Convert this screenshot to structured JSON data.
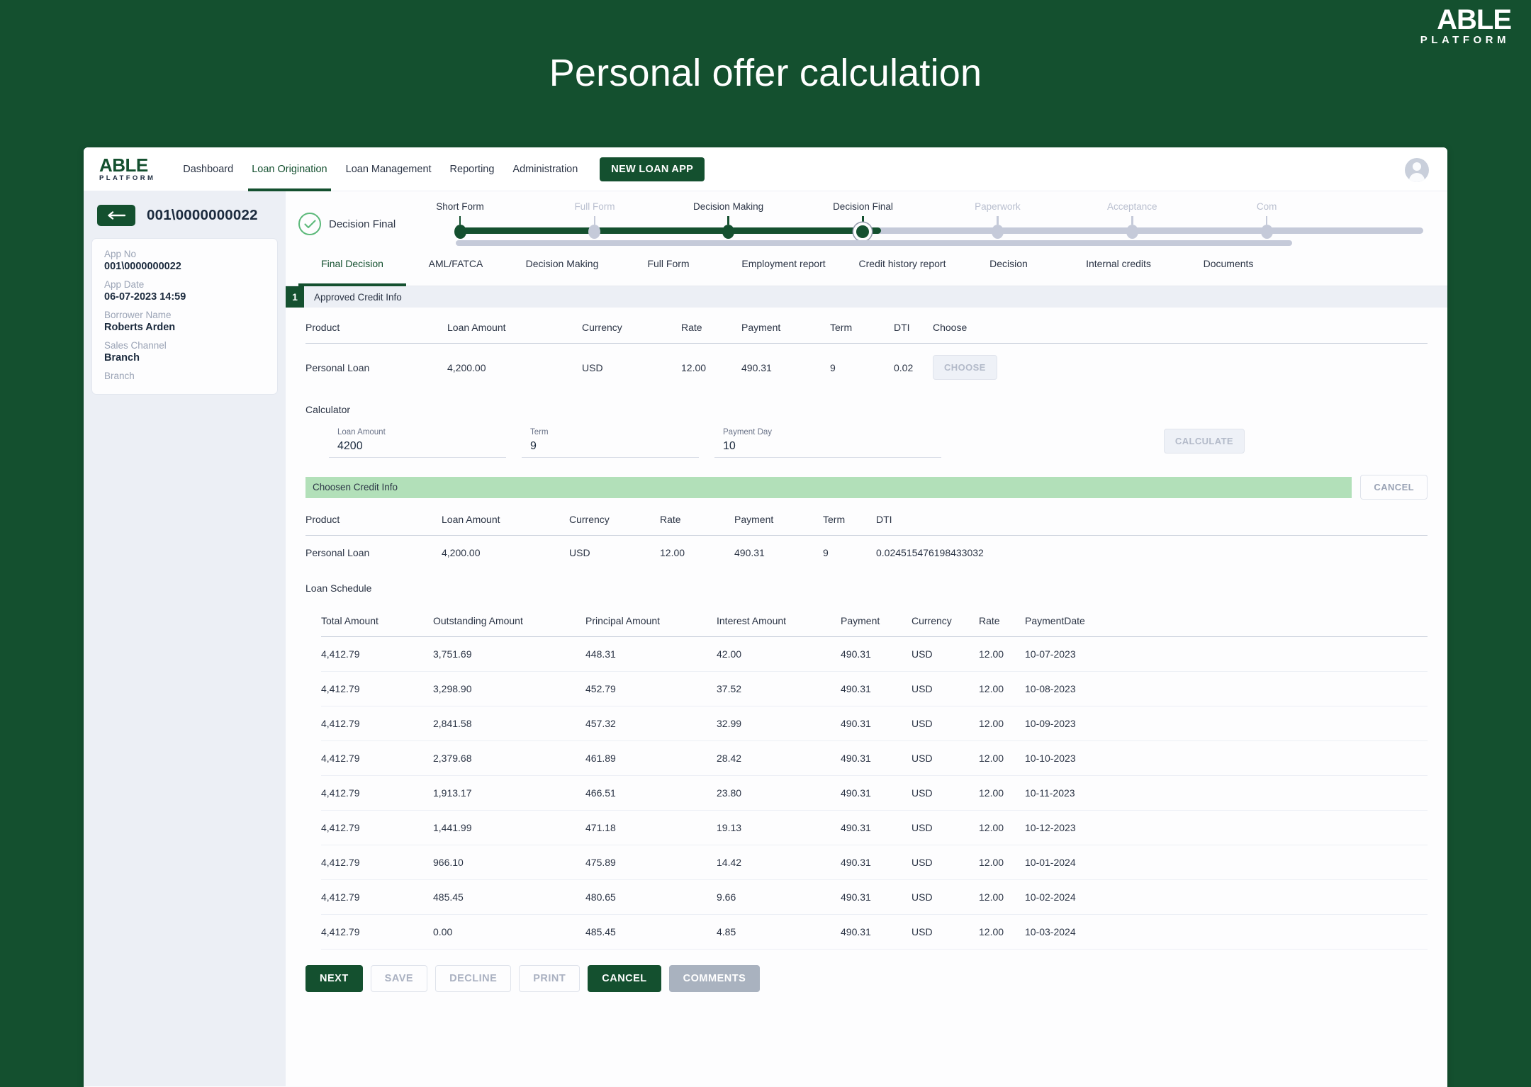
{
  "slide": {
    "title": "Personal offer calculation",
    "brand": {
      "main": "ABLE",
      "sub": "PLATFORM"
    }
  },
  "topnav": {
    "logo": {
      "main": "ABLE",
      "sub": "PLATFORM"
    },
    "items": [
      {
        "label": "Dashboard",
        "active": false
      },
      {
        "label": "Loan Origination",
        "active": true
      },
      {
        "label": "Loan Management",
        "active": false
      },
      {
        "label": "Reporting",
        "active": false
      },
      {
        "label": "Administration",
        "active": false
      }
    ],
    "new_loan_label": "NEW LOAN APP"
  },
  "sidebar": {
    "app_no_header": "001\\0000000022",
    "fields": [
      {
        "label": "App No",
        "value": "001\\0000000022"
      },
      {
        "label": "App Date",
        "value": "06-07-2023 14:59"
      },
      {
        "label": "Borrower Name",
        "value": "Roberts Arden"
      },
      {
        "label": "Sales Channel",
        "value": "Branch"
      },
      {
        "label": "Branch",
        "value": ""
      }
    ]
  },
  "status": {
    "label": "Decision Final"
  },
  "stepper": {
    "steps": [
      {
        "label": "Short Form",
        "state": "done"
      },
      {
        "label": "Full Form",
        "state": "skipped"
      },
      {
        "label": "Decision Making",
        "state": "done"
      },
      {
        "label": "Decision Final",
        "state": "current"
      },
      {
        "label": "Paperwork",
        "state": "todo"
      },
      {
        "label": "Acceptance",
        "state": "todo"
      },
      {
        "label": "Com",
        "state": "todo"
      }
    ]
  },
  "tabs": [
    {
      "label": "Final Decision",
      "active": true
    },
    {
      "label": "AML/FATCA",
      "active": false
    },
    {
      "label": "Decision Making",
      "active": false
    },
    {
      "label": "Full Form",
      "active": false
    },
    {
      "label": "Employment report",
      "active": false
    },
    {
      "label": "Credit history report",
      "active": false
    },
    {
      "label": "Decision",
      "active": false
    },
    {
      "label": "Internal credits",
      "active": false
    },
    {
      "label": "Documents",
      "active": false
    }
  ],
  "approved": {
    "badge": "1",
    "band_title": "Approved Credit Info",
    "headers": [
      "Product",
      "Loan Amount",
      "Currency",
      "Rate",
      "Payment",
      "Term",
      "DTI",
      "Choose"
    ],
    "row": {
      "product": "Personal Loan",
      "loan_amount": "4,200.00",
      "currency": "USD",
      "rate": "12.00",
      "payment": "490.31",
      "term": "9",
      "dti": "0.02",
      "choose_label": "CHOOSE"
    }
  },
  "calculator": {
    "title": "Calculator",
    "loan_amount": {
      "label": "Loan Amount",
      "value": "4200"
    },
    "term": {
      "label": "Term",
      "value": "9"
    },
    "payment_day": {
      "label": "Payment Day",
      "value": "10"
    },
    "calculate_label": "CALCULATE"
  },
  "chosen": {
    "band_title": "Choosen Credit Info",
    "cancel_label": "CANCEL",
    "headers": [
      "Product",
      "Loan Amount",
      "Currency",
      "Rate",
      "Payment",
      "Term",
      "DTI"
    ],
    "row": {
      "product": "Personal Loan",
      "loan_amount": "4,200.00",
      "currency": "USD",
      "rate": "12.00",
      "payment": "490.31",
      "term": "9",
      "dti": "0.024515476198433032"
    }
  },
  "schedule": {
    "title": "Loan Schedule",
    "headers": [
      "Total Amount",
      "Outstanding Amount",
      "Principal Amount",
      "Interest Amount",
      "Payment",
      "Currency",
      "Rate",
      "PaymentDate"
    ],
    "rows": [
      [
        "4,412.79",
        "3,751.69",
        "448.31",
        "42.00",
        "490.31",
        "USD",
        "12.00",
        "10-07-2023"
      ],
      [
        "4,412.79",
        "3,298.90",
        "452.79",
        "37.52",
        "490.31",
        "USD",
        "12.00",
        "10-08-2023"
      ],
      [
        "4,412.79",
        "2,841.58",
        "457.32",
        "32.99",
        "490.31",
        "USD",
        "12.00",
        "10-09-2023"
      ],
      [
        "4,412.79",
        "2,379.68",
        "461.89",
        "28.42",
        "490.31",
        "USD",
        "12.00",
        "10-10-2023"
      ],
      [
        "4,412.79",
        "1,913.17",
        "466.51",
        "23.80",
        "490.31",
        "USD",
        "12.00",
        "10-11-2023"
      ],
      [
        "4,412.79",
        "1,441.99",
        "471.18",
        "19.13",
        "490.31",
        "USD",
        "12.00",
        "10-12-2023"
      ],
      [
        "4,412.79",
        "966.10",
        "475.89",
        "14.42",
        "490.31",
        "USD",
        "12.00",
        "10-01-2024"
      ],
      [
        "4,412.79",
        "485.45",
        "480.65",
        "9.66",
        "490.31",
        "USD",
        "12.00",
        "10-02-2024"
      ],
      [
        "4,412.79",
        "0.00",
        "485.45",
        "4.85",
        "490.31",
        "USD",
        "12.00",
        "10-03-2024"
      ]
    ]
  },
  "footer": {
    "buttons": [
      {
        "label": "NEXT",
        "style": "primary"
      },
      {
        "label": "SAVE",
        "style": "outline"
      },
      {
        "label": "DECLINE",
        "style": "outline"
      },
      {
        "label": "PRINT",
        "style": "outline"
      },
      {
        "label": "CANCEL",
        "style": "primary"
      },
      {
        "label": "COMMENTS",
        "style": "grey"
      }
    ]
  },
  "colors": {
    "brand_green": "#14502f",
    "check_green": "#5cb97a",
    "chosen_band": "#b2e0b9",
    "muted": "#b9bfcf"
  }
}
